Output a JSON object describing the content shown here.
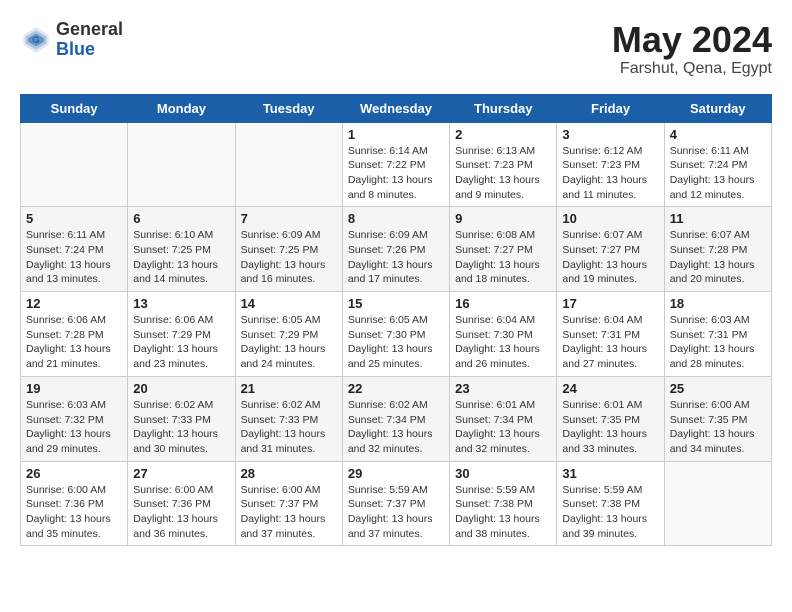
{
  "logo": {
    "general": "General",
    "blue": "Blue"
  },
  "title": "May 2024",
  "subtitle": "Farshut, Qena, Egypt",
  "weekdays": [
    "Sunday",
    "Monday",
    "Tuesday",
    "Wednesday",
    "Thursday",
    "Friday",
    "Saturday"
  ],
  "weeks": [
    [
      {
        "day": "",
        "info": ""
      },
      {
        "day": "",
        "info": ""
      },
      {
        "day": "",
        "info": ""
      },
      {
        "day": "1",
        "info": "Sunrise: 6:14 AM\nSunset: 7:22 PM\nDaylight: 13 hours\nand 8 minutes."
      },
      {
        "day": "2",
        "info": "Sunrise: 6:13 AM\nSunset: 7:23 PM\nDaylight: 13 hours\nand 9 minutes."
      },
      {
        "day": "3",
        "info": "Sunrise: 6:12 AM\nSunset: 7:23 PM\nDaylight: 13 hours\nand 11 minutes."
      },
      {
        "day": "4",
        "info": "Sunrise: 6:11 AM\nSunset: 7:24 PM\nDaylight: 13 hours\nand 12 minutes."
      }
    ],
    [
      {
        "day": "5",
        "info": "Sunrise: 6:11 AM\nSunset: 7:24 PM\nDaylight: 13 hours\nand 13 minutes."
      },
      {
        "day": "6",
        "info": "Sunrise: 6:10 AM\nSunset: 7:25 PM\nDaylight: 13 hours\nand 14 minutes."
      },
      {
        "day": "7",
        "info": "Sunrise: 6:09 AM\nSunset: 7:25 PM\nDaylight: 13 hours\nand 16 minutes."
      },
      {
        "day": "8",
        "info": "Sunrise: 6:09 AM\nSunset: 7:26 PM\nDaylight: 13 hours\nand 17 minutes."
      },
      {
        "day": "9",
        "info": "Sunrise: 6:08 AM\nSunset: 7:27 PM\nDaylight: 13 hours\nand 18 minutes."
      },
      {
        "day": "10",
        "info": "Sunrise: 6:07 AM\nSunset: 7:27 PM\nDaylight: 13 hours\nand 19 minutes."
      },
      {
        "day": "11",
        "info": "Sunrise: 6:07 AM\nSunset: 7:28 PM\nDaylight: 13 hours\nand 20 minutes."
      }
    ],
    [
      {
        "day": "12",
        "info": "Sunrise: 6:06 AM\nSunset: 7:28 PM\nDaylight: 13 hours\nand 21 minutes."
      },
      {
        "day": "13",
        "info": "Sunrise: 6:06 AM\nSunset: 7:29 PM\nDaylight: 13 hours\nand 23 minutes."
      },
      {
        "day": "14",
        "info": "Sunrise: 6:05 AM\nSunset: 7:29 PM\nDaylight: 13 hours\nand 24 minutes."
      },
      {
        "day": "15",
        "info": "Sunrise: 6:05 AM\nSunset: 7:30 PM\nDaylight: 13 hours\nand 25 minutes."
      },
      {
        "day": "16",
        "info": "Sunrise: 6:04 AM\nSunset: 7:30 PM\nDaylight: 13 hours\nand 26 minutes."
      },
      {
        "day": "17",
        "info": "Sunrise: 6:04 AM\nSunset: 7:31 PM\nDaylight: 13 hours\nand 27 minutes."
      },
      {
        "day": "18",
        "info": "Sunrise: 6:03 AM\nSunset: 7:31 PM\nDaylight: 13 hours\nand 28 minutes."
      }
    ],
    [
      {
        "day": "19",
        "info": "Sunrise: 6:03 AM\nSunset: 7:32 PM\nDaylight: 13 hours\nand 29 minutes."
      },
      {
        "day": "20",
        "info": "Sunrise: 6:02 AM\nSunset: 7:33 PM\nDaylight: 13 hours\nand 30 minutes."
      },
      {
        "day": "21",
        "info": "Sunrise: 6:02 AM\nSunset: 7:33 PM\nDaylight: 13 hours\nand 31 minutes."
      },
      {
        "day": "22",
        "info": "Sunrise: 6:02 AM\nSunset: 7:34 PM\nDaylight: 13 hours\nand 32 minutes."
      },
      {
        "day": "23",
        "info": "Sunrise: 6:01 AM\nSunset: 7:34 PM\nDaylight: 13 hours\nand 32 minutes."
      },
      {
        "day": "24",
        "info": "Sunrise: 6:01 AM\nSunset: 7:35 PM\nDaylight: 13 hours\nand 33 minutes."
      },
      {
        "day": "25",
        "info": "Sunrise: 6:00 AM\nSunset: 7:35 PM\nDaylight: 13 hours\nand 34 minutes."
      }
    ],
    [
      {
        "day": "26",
        "info": "Sunrise: 6:00 AM\nSunset: 7:36 PM\nDaylight: 13 hours\nand 35 minutes."
      },
      {
        "day": "27",
        "info": "Sunrise: 6:00 AM\nSunset: 7:36 PM\nDaylight: 13 hours\nand 36 minutes."
      },
      {
        "day": "28",
        "info": "Sunrise: 6:00 AM\nSunset: 7:37 PM\nDaylight: 13 hours\nand 37 minutes."
      },
      {
        "day": "29",
        "info": "Sunrise: 5:59 AM\nSunset: 7:37 PM\nDaylight: 13 hours\nand 37 minutes."
      },
      {
        "day": "30",
        "info": "Sunrise: 5:59 AM\nSunset: 7:38 PM\nDaylight: 13 hours\nand 38 minutes."
      },
      {
        "day": "31",
        "info": "Sunrise: 5:59 AM\nSunset: 7:38 PM\nDaylight: 13 hours\nand 39 minutes."
      },
      {
        "day": "",
        "info": ""
      }
    ]
  ]
}
